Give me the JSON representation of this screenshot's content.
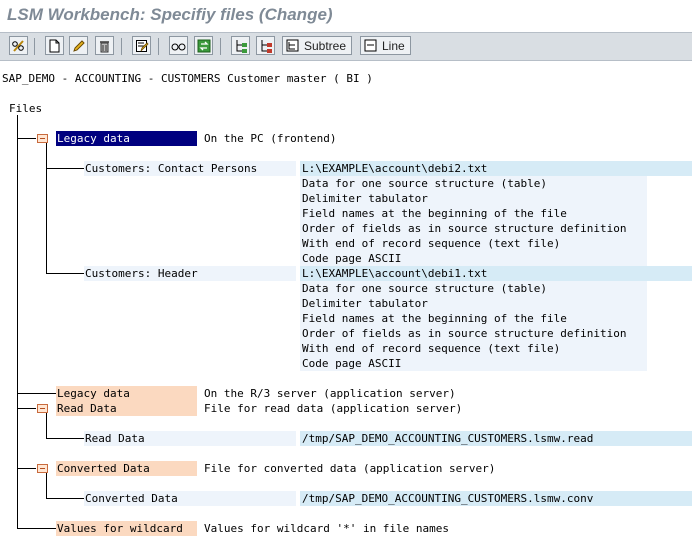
{
  "window": {
    "title": "LSM Workbench: Specifiy files (Change)"
  },
  "toolbar": {
    "buttons": [
      {
        "name": "display-change-button",
        "icon": "pencil-glasses-icon"
      },
      {
        "name": "create-button",
        "icon": "new-document-icon"
      },
      {
        "name": "change-button",
        "icon": "pencil-icon"
      },
      {
        "name": "delete-button",
        "icon": "trash-icon"
      },
      {
        "name": "edit-attributes-button",
        "icon": "edit-list-icon"
      },
      {
        "name": "details-button",
        "icon": "glasses-icon"
      },
      {
        "name": "refresh-button",
        "icon": "arrows-icon"
      },
      {
        "name": "expand-button",
        "icon": "expand-tree-icon"
      },
      {
        "name": "collapse-button",
        "icon": "collapse-tree-icon"
      }
    ],
    "subtree_label": "Subtree",
    "line_label": "Line"
  },
  "header": "SAP_DEMO - ACCOUNTING - CUSTOMERS Customer master ( BI )",
  "tree": {
    "root": "Files",
    "legacy_pc": {
      "label": "Legacy data",
      "desc": "On the PC (frontend)",
      "files": [
        {
          "label": "Customers: Contact Persons",
          "path": "L:\\EXAMPLE\\account\\debi2.txt",
          "details": [
            "Data for one source structure (table)",
            "Delimiter tabulator",
            "Field names at the beginning of the file",
            "Order of fields as in source structure definition",
            "With end of record sequence (text file)",
            "Code page ASCII"
          ]
        },
        {
          "label": "Customers: Header",
          "path": "L:\\EXAMPLE\\account\\debi1.txt",
          "details": [
            "Data for one source structure (table)",
            "Delimiter tabulator",
            "Field names at the beginning of the file",
            "Order of fields as in source structure definition",
            "With end of record sequence (text file)",
            "Code page ASCII"
          ]
        }
      ]
    },
    "legacy_server": {
      "label": "Legacy data",
      "desc": "On the R/3 server (application server)"
    },
    "read_data": {
      "label": "Read Data",
      "desc": "File for read data (application server)",
      "child_label": "Read Data",
      "child_path": "/tmp/SAP_DEMO_ACCOUNTING_CUSTOMERS.lsmw.read"
    },
    "converted_data": {
      "label": "Converted Data",
      "desc": "File for converted data (application server)",
      "child_label": "Converted Data",
      "child_path": "/tmp/SAP_DEMO_ACCOUNTING_CUSTOMERS.lsmw.conv"
    },
    "wildcard": {
      "label": "Values for wildcard",
      "desc": "Values for wildcard '*' in file names"
    }
  }
}
